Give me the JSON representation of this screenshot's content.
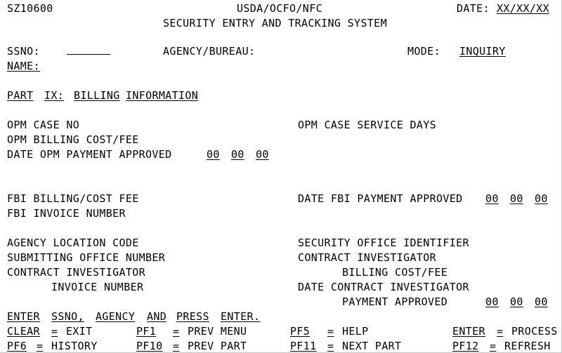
{
  "screen": {
    "id": "SZ10600",
    "agency_header": "USDA/OCFO/NFC",
    "system_title": "SECURITY ENTRY AND TRACKING SYSTEM",
    "date_label": "DATE:",
    "date_value": "XX/XX/XX"
  },
  "form": {
    "ssno_label": "SSNO:",
    "ssno_value": "",
    "name_label": "NAME:",
    "name_value": "",
    "agency_bureau_label": "AGENCY/BUREAU:",
    "agency_bureau_value": "",
    "mode_label": "MODE:",
    "mode_value": "INQUIRY"
  },
  "part": {
    "word1": "PART",
    "word2": "IX:",
    "word3": "BILLING",
    "word4": "INFORMATION"
  },
  "fields": {
    "opm_case_no": "OPM CASE NO",
    "opm_case_service_days": "OPM CASE SERVICE DAYS",
    "opm_billing_cost_fee": "OPM BILLING COST/FEE",
    "date_opm_payment_approved": "DATE OPM PAYMENT APPROVED",
    "opm_date_mm": "00",
    "opm_date_dd": "00",
    "opm_date_yy": "00",
    "fbi_billing_cost_fee": "FBI BILLING/COST FEE",
    "date_fbi_payment_approved": "DATE FBI PAYMENT APPROVED",
    "fbi_date_mm": "00",
    "fbi_date_dd": "00",
    "fbi_date_yy": "00",
    "fbi_invoice_number": "FBI INVOICE NUMBER",
    "agency_location_code": "AGENCY LOCATION CODE",
    "security_office_identifier": "SECURITY OFFICE IDENTIFIER",
    "submitting_office_number": "SUBMITTING OFFICE NUMBER",
    "contract_investigator_left": "CONTRACT INVESTIGATOR",
    "contract_investigator_right": "CONTRACT INVESTIGATOR",
    "invoice_number": "INVOICE NUMBER",
    "billing_cost_fee": "BILLING COST/FEE",
    "date_contract_investigator": "DATE CONTRACT INVESTIGATOR",
    "payment_approved": "PAYMENT APPROVED",
    "ci_date_mm": "00",
    "ci_date_dd": "00",
    "ci_date_yy": "00"
  },
  "instruction": {
    "word1": "ENTER",
    "word2": "SSNO,",
    "word3": "AGENCY",
    "word4": "AND",
    "word5": "PRESS",
    "word6": "ENTER."
  },
  "function_keys": [
    {
      "key": "CLEAR",
      "eq": "=",
      "action": "EXIT"
    },
    {
      "key": "PF1",
      "eq": "=",
      "action": "PREV MENU"
    },
    {
      "key": "PF5",
      "eq": "=",
      "action": "HELP"
    },
    {
      "key": "ENTER",
      "eq": "=",
      "action": "PROCESS"
    },
    {
      "key": "PF6",
      "eq": "=",
      "action": "HISTORY"
    },
    {
      "key": "PF10",
      "eq": "=",
      "action": "PREV PART"
    },
    {
      "key": "PF11",
      "eq": "=",
      "action": "NEXT PART"
    },
    {
      "key": "PF12",
      "eq": "=",
      "action": "REFRESH"
    }
  ],
  "colors": {
    "background": "#ffffff",
    "text": "#000000",
    "border": "#c8c8c8"
  }
}
